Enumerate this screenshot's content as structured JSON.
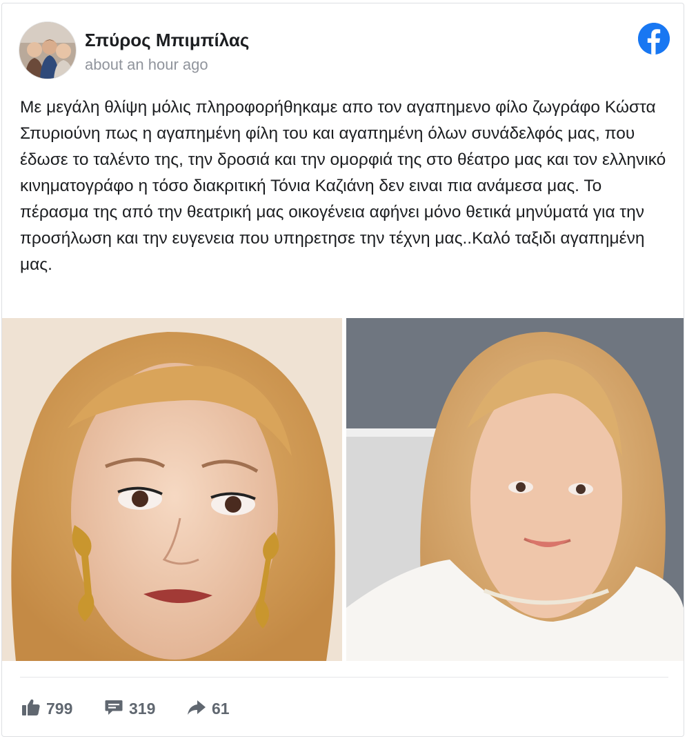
{
  "post": {
    "author_name": "Σπύρος Μπιμπίλας",
    "timestamp": "about an hour ago",
    "text": "Με μεγάλη θλίψη μόλις πληροφορήθηκαμε απο τον αγαπημενο φίλο ζωγράφο Κώστα Σπυριούνη πως η αγαπημένη φίλη του και αγαπημένη όλων συνάδελφός μας, που έδωσε το ταλέντο της, την δροσιά και την ομορφιά της στο θέατρο μας και τον ελληνικό κινηματογράφο η τόσο διακριτική Τόνια Καζιάνη δεν ειναι πια ανάμεσα μας. Το πέρασμα της από την θεατρική μας οικογένεια αφήνει μόνο θετικά μηνύματά για την προσήλωση και την ευγενεια που υπηρετησε την τέχνη μας..Καλό ταξιδι αγαπημένη μας."
  },
  "stats": {
    "likes": "799",
    "comments": "319",
    "shares": "61"
  },
  "icons": {
    "platform": "facebook-icon",
    "like": "thumbs-up-icon",
    "comment": "comment-icon",
    "share": "share-arrow-icon"
  },
  "colors": {
    "facebook_blue": "#1877f2",
    "stat_gray": "#606770",
    "timestamp_gray": "#90949c"
  }
}
